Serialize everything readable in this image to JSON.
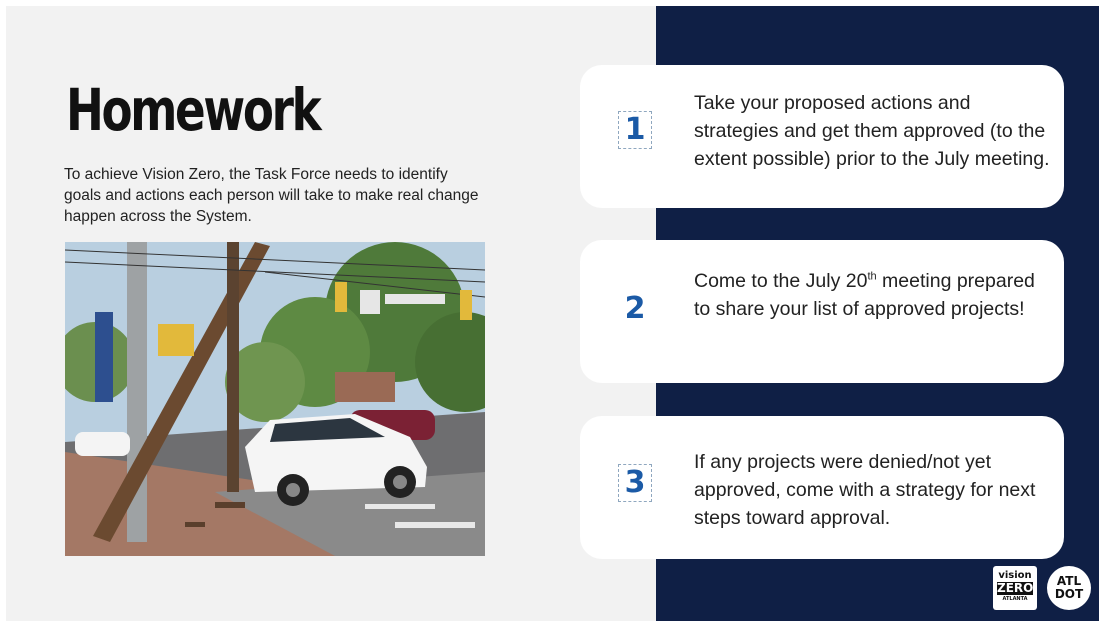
{
  "slide": {
    "title": "Homework",
    "intro": "To achieve Vision Zero, the Task Force needs to identify goals and actions each person will take to make real change happen across the System."
  },
  "steps": [
    {
      "number": "1",
      "text": "Take your proposed actions and strategies and get them approved (to the extent possible) prior to the July meeting."
    },
    {
      "number": "2",
      "text_before": "Come to the July 20",
      "superscript": "th",
      "text_after": " meeting prepared to share your list of approved projects!"
    },
    {
      "number": "3",
      "text": "If any projects were denied/not yet approved, come with a strategy for next steps toward approval."
    }
  ],
  "logos": {
    "vision_zero": {
      "line1": "vision",
      "line2": "ZERO",
      "line3": "ATLANTA"
    },
    "atl_dot": {
      "line1": "ATL",
      "line2": "DOT"
    }
  },
  "colors": {
    "panel": "#0f1f45",
    "background": "#f2f2f2",
    "number_accent": "#1b5aa6"
  }
}
